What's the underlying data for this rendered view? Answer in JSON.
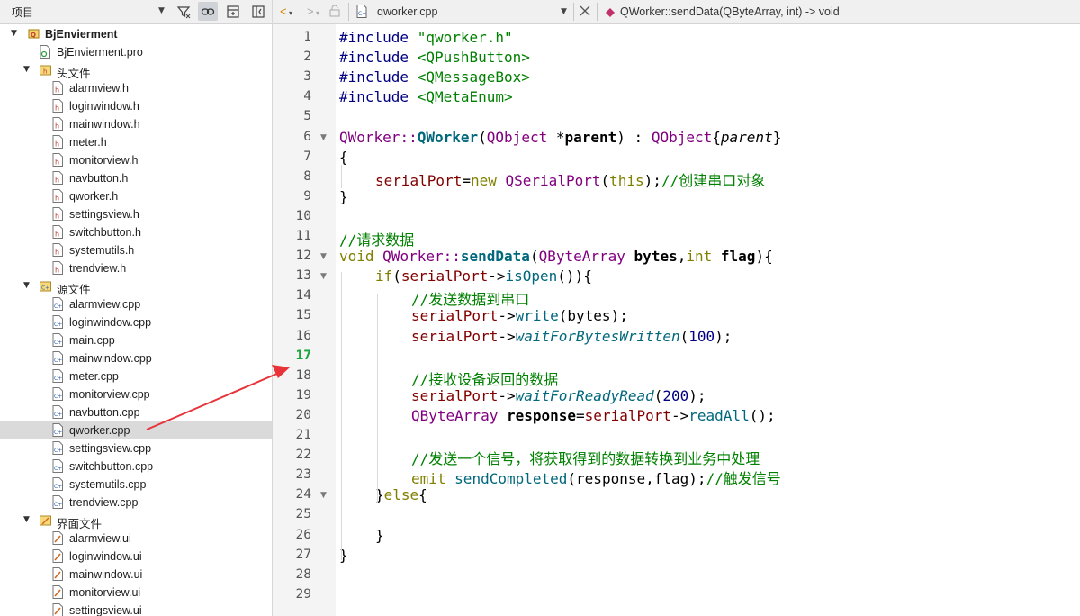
{
  "project_pane": {
    "title": "项目",
    "root": "BjEnvierment",
    "pro_file": "BjEnvierment.pro",
    "groups": [
      {
        "label": "头文件",
        "files": [
          "alarmview.h",
          "loginwindow.h",
          "mainwindow.h",
          "meter.h",
          "monitorview.h",
          "navbutton.h",
          "qworker.h",
          "settingsview.h",
          "switchbutton.h",
          "systemutils.h",
          "trendview.h"
        ]
      },
      {
        "label": "源文件",
        "files": [
          "alarmview.cpp",
          "loginwindow.cpp",
          "main.cpp",
          "mainwindow.cpp",
          "meter.cpp",
          "monitorview.cpp",
          "navbutton.cpp",
          "qworker.cpp",
          "settingsview.cpp",
          "switchbutton.cpp",
          "systemutils.cpp",
          "trendview.cpp"
        ]
      },
      {
        "label": "界面文件",
        "files": [
          "alarmview.ui",
          "loginwindow.ui",
          "mainwindow.ui",
          "monitorview.ui",
          "settingsview.ui"
        ]
      }
    ],
    "selected_file": "qworker.cpp"
  },
  "editor": {
    "open_file": "qworker.cpp",
    "function_breadcrumb": "QWorker::sendData(QByteArray, int) -> void",
    "current_line": 17,
    "line_numbers": [
      "1",
      "2",
      "3",
      "4",
      "5",
      "6",
      "7",
      "8",
      "9",
      "10",
      "11",
      "12",
      "13",
      "14",
      "15",
      "16",
      "17",
      "18",
      "19",
      "20",
      "21",
      "22",
      "23",
      "24",
      "25",
      "26",
      "27",
      "28",
      "29"
    ],
    "code": {
      "l1_kw": "#include",
      "l1_s": "\"qworker.h\"",
      "l2_kw": "#include",
      "l2_s": "<QPushButton>",
      "l3_kw": "#include",
      "l3_s": "<QMessageBox>",
      "l4_kw": "#include",
      "l4_s": "<QMetaEnum>",
      "l6_a": "QWorker",
      "l6_b": "::",
      "l6_c": "QWorker",
      "l6_d": "(",
      "l6_e": "QObject",
      "l6_f": " *",
      "l6_g": "parent",
      "l6_h": ") : ",
      "l6_i": "QObject",
      "l6_j": "{",
      "l6_k": "parent",
      "l6_l": "}",
      "l7": "{",
      "l8_a": "serialPort",
      "l8_b": "=",
      "l8_c": "new",
      "l8_d": " ",
      "l8_e": "QSerialPort",
      "l8_f": "(",
      "l8_g": "this",
      "l8_h": ");",
      "l8_i": "//创建串口对象",
      "l9": "}",
      "l11": "//请求数据",
      "l12_a": "void",
      "l12_b": " ",
      "l12_c": "QWorker",
      "l12_d": "::",
      "l12_e": "sendData",
      "l12_f": "(",
      "l12_g": "QByteArray",
      "l12_h": " ",
      "l12_i": "bytes",
      "l12_j": ",",
      "l12_k": "int",
      "l12_l": " ",
      "l12_m": "flag",
      "l12_n": "){",
      "l13_a": "if",
      "l13_b": "(",
      "l13_c": "serialPort",
      "l13_d": "->",
      "l13_e": "isOpen",
      "l13_f": "()){",
      "l14": "//发送数据到串口",
      "l15_a": "serialPort",
      "l15_b": "->",
      "l15_c": "write",
      "l15_d": "(bytes);",
      "l16_a": "serialPort",
      "l16_b": "->",
      "l16_c": "waitForBytesWritten",
      "l16_d": "(",
      "l16_e": "100",
      "l16_f": ");",
      "l18": "//接收设备返回的数据",
      "l19_a": "serialPort",
      "l19_b": "->",
      "l19_c": "waitForReadyRead",
      "l19_d": "(",
      "l19_e": "200",
      "l19_f": ");",
      "l20_a": "QByteArray",
      "l20_b": " ",
      "l20_c": "response",
      "l20_d": "=",
      "l20_e": "serialPort",
      "l20_f": "->",
      "l20_g": "readAll",
      "l20_h": "();",
      "l22": "//发送一个信号，将获取得到的数据转换到业务中处理",
      "l23_a": "emit",
      "l23_b": " ",
      "l23_c": "sendCompleted",
      "l23_d": "(response,flag);",
      "l23_e": "//触发信号",
      "l24_a": "}",
      "l24_b": "else",
      "l24_c": "{",
      "l26": "}",
      "l27": "}"
    }
  },
  "colors": {
    "annotation_arrow": "#e8333a",
    "current_line_number": "#1aa33a",
    "keyword": "#808000",
    "type": "#800080",
    "comment": "#008000"
  }
}
